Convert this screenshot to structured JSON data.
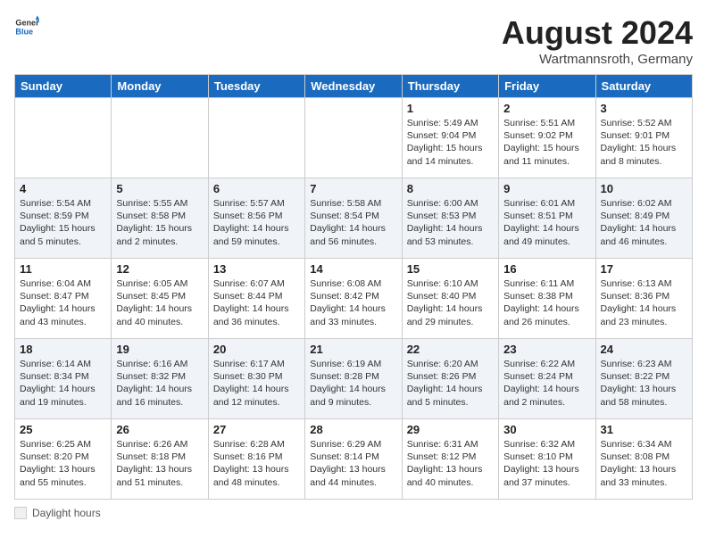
{
  "header": {
    "logo_general": "General",
    "logo_blue": "Blue",
    "month_year": "August 2024",
    "location": "Wartmannsroth, Germany"
  },
  "weekdays": [
    "Sunday",
    "Monday",
    "Tuesday",
    "Wednesday",
    "Thursday",
    "Friday",
    "Saturday"
  ],
  "weeks": [
    [
      {
        "day": "",
        "info": ""
      },
      {
        "day": "",
        "info": ""
      },
      {
        "day": "",
        "info": ""
      },
      {
        "day": "",
        "info": ""
      },
      {
        "day": "1",
        "info": "Sunrise: 5:49 AM\nSunset: 9:04 PM\nDaylight: 15 hours\nand 14 minutes."
      },
      {
        "day": "2",
        "info": "Sunrise: 5:51 AM\nSunset: 9:02 PM\nDaylight: 15 hours\nand 11 minutes."
      },
      {
        "day": "3",
        "info": "Sunrise: 5:52 AM\nSunset: 9:01 PM\nDaylight: 15 hours\nand 8 minutes."
      }
    ],
    [
      {
        "day": "4",
        "info": "Sunrise: 5:54 AM\nSunset: 8:59 PM\nDaylight: 15 hours\nand 5 minutes."
      },
      {
        "day": "5",
        "info": "Sunrise: 5:55 AM\nSunset: 8:58 PM\nDaylight: 15 hours\nand 2 minutes."
      },
      {
        "day": "6",
        "info": "Sunrise: 5:57 AM\nSunset: 8:56 PM\nDaylight: 14 hours\nand 59 minutes."
      },
      {
        "day": "7",
        "info": "Sunrise: 5:58 AM\nSunset: 8:54 PM\nDaylight: 14 hours\nand 56 minutes."
      },
      {
        "day": "8",
        "info": "Sunrise: 6:00 AM\nSunset: 8:53 PM\nDaylight: 14 hours\nand 53 minutes."
      },
      {
        "day": "9",
        "info": "Sunrise: 6:01 AM\nSunset: 8:51 PM\nDaylight: 14 hours\nand 49 minutes."
      },
      {
        "day": "10",
        "info": "Sunrise: 6:02 AM\nSunset: 8:49 PM\nDaylight: 14 hours\nand 46 minutes."
      }
    ],
    [
      {
        "day": "11",
        "info": "Sunrise: 6:04 AM\nSunset: 8:47 PM\nDaylight: 14 hours\nand 43 minutes."
      },
      {
        "day": "12",
        "info": "Sunrise: 6:05 AM\nSunset: 8:45 PM\nDaylight: 14 hours\nand 40 minutes."
      },
      {
        "day": "13",
        "info": "Sunrise: 6:07 AM\nSunset: 8:44 PM\nDaylight: 14 hours\nand 36 minutes."
      },
      {
        "day": "14",
        "info": "Sunrise: 6:08 AM\nSunset: 8:42 PM\nDaylight: 14 hours\nand 33 minutes."
      },
      {
        "day": "15",
        "info": "Sunrise: 6:10 AM\nSunset: 8:40 PM\nDaylight: 14 hours\nand 29 minutes."
      },
      {
        "day": "16",
        "info": "Sunrise: 6:11 AM\nSunset: 8:38 PM\nDaylight: 14 hours\nand 26 minutes."
      },
      {
        "day": "17",
        "info": "Sunrise: 6:13 AM\nSunset: 8:36 PM\nDaylight: 14 hours\nand 23 minutes."
      }
    ],
    [
      {
        "day": "18",
        "info": "Sunrise: 6:14 AM\nSunset: 8:34 PM\nDaylight: 14 hours\nand 19 minutes."
      },
      {
        "day": "19",
        "info": "Sunrise: 6:16 AM\nSunset: 8:32 PM\nDaylight: 14 hours\nand 16 minutes."
      },
      {
        "day": "20",
        "info": "Sunrise: 6:17 AM\nSunset: 8:30 PM\nDaylight: 14 hours\nand 12 minutes."
      },
      {
        "day": "21",
        "info": "Sunrise: 6:19 AM\nSunset: 8:28 PM\nDaylight: 14 hours\nand 9 minutes."
      },
      {
        "day": "22",
        "info": "Sunrise: 6:20 AM\nSunset: 8:26 PM\nDaylight: 14 hours\nand 5 minutes."
      },
      {
        "day": "23",
        "info": "Sunrise: 6:22 AM\nSunset: 8:24 PM\nDaylight: 14 hours\nand 2 minutes."
      },
      {
        "day": "24",
        "info": "Sunrise: 6:23 AM\nSunset: 8:22 PM\nDaylight: 13 hours\nand 58 minutes."
      }
    ],
    [
      {
        "day": "25",
        "info": "Sunrise: 6:25 AM\nSunset: 8:20 PM\nDaylight: 13 hours\nand 55 minutes."
      },
      {
        "day": "26",
        "info": "Sunrise: 6:26 AM\nSunset: 8:18 PM\nDaylight: 13 hours\nand 51 minutes."
      },
      {
        "day": "27",
        "info": "Sunrise: 6:28 AM\nSunset: 8:16 PM\nDaylight: 13 hours\nand 48 minutes."
      },
      {
        "day": "28",
        "info": "Sunrise: 6:29 AM\nSunset: 8:14 PM\nDaylight: 13 hours\nand 44 minutes."
      },
      {
        "day": "29",
        "info": "Sunrise: 6:31 AM\nSunset: 8:12 PM\nDaylight: 13 hours\nand 40 minutes."
      },
      {
        "day": "30",
        "info": "Sunrise: 6:32 AM\nSunset: 8:10 PM\nDaylight: 13 hours\nand 37 minutes."
      },
      {
        "day": "31",
        "info": "Sunrise: 6:34 AM\nSunset: 8:08 PM\nDaylight: 13 hours\nand 33 minutes."
      }
    ]
  ],
  "footer": {
    "daylight_label": "Daylight hours"
  },
  "colors": {
    "header_bg": "#1a6bbf",
    "accent": "#1a6bbf"
  }
}
